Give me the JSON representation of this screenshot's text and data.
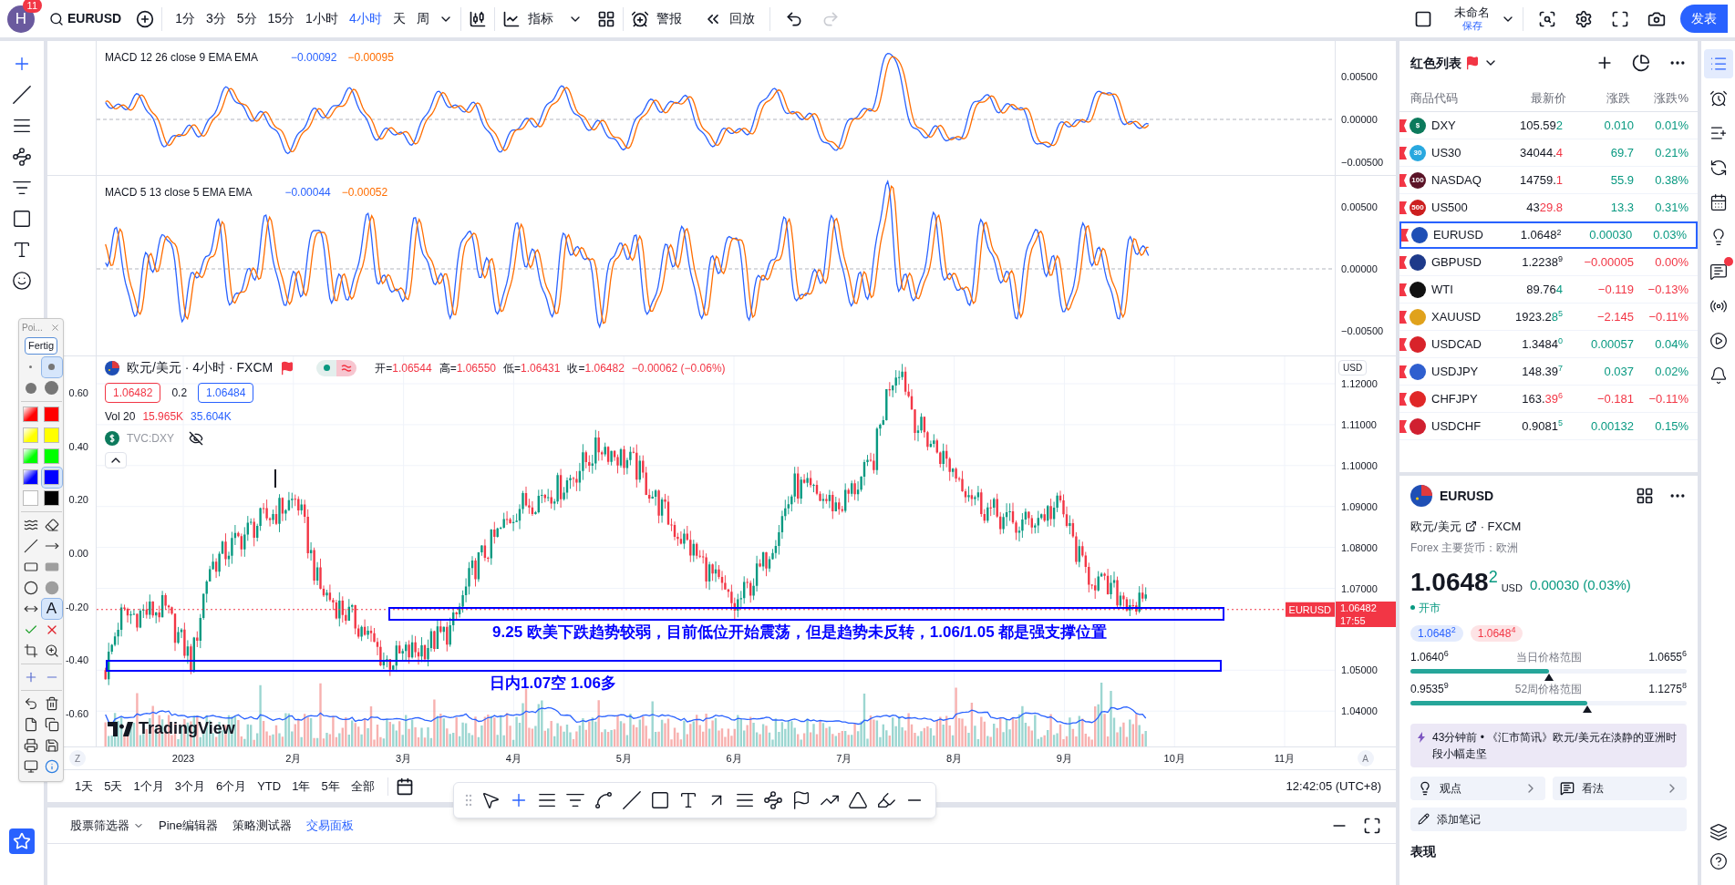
{
  "topbar": {
    "avatar": "H",
    "badge": "11",
    "symbol": "EURUSD",
    "intervals": [
      {
        "label": "1分",
        "selected": false
      },
      {
        "label": "3分",
        "selected": false
      },
      {
        "label": "5分",
        "selected": false
      },
      {
        "label": "15分",
        "selected": false
      },
      {
        "label": "1小时",
        "selected": false
      },
      {
        "label": "4小时",
        "selected": true
      },
      {
        "label": "天",
        "selected": false
      },
      {
        "label": "周",
        "selected": false
      }
    ],
    "indicators": "指标",
    "alert": "警报",
    "replay": "回放",
    "redo_disabled": true,
    "layout_name": "未命名",
    "save": "保存",
    "publish": "发表"
  },
  "left_tools": [
    {
      "kind": "crosshair",
      "selected": true
    },
    {
      "kind": "line",
      "selected": false
    },
    {
      "kind": "hlines",
      "selected": false
    },
    {
      "kind": "pattern",
      "selected": false
    },
    {
      "kind": "fib",
      "selected": false
    },
    {
      "kind": "rect",
      "selected": false
    },
    {
      "kind": "text",
      "selected": false
    },
    {
      "kind": "emoji",
      "selected": false
    }
  ],
  "panes": [
    {
      "kind": "macd_slow",
      "legend": "MACD 12 26 close 9 EMA EMA",
      "values": [
        {
          "text": "−0.00092",
          "color": "#2962ff"
        },
        {
          "text": "−0.00095",
          "color": "#ff6d00"
        }
      ],
      "yticks": [
        "0.00500",
        "0.00000",
        "−0.00500"
      ]
    },
    {
      "kind": "macd_fast",
      "legend": "MACD 5 13 close 5 EMA EMA",
      "values": [
        {
          "text": "−0.00044",
          "color": "#2962ff"
        },
        {
          "text": "−0.00052",
          "color": "#ff6d00"
        }
      ],
      "yticks": [
        "0.00500",
        "0.00000",
        "−0.00500"
      ]
    }
  ],
  "main": {
    "title": "欧元/美元 · 4小时 · FXCM",
    "ohlc": [
      {
        "label": "开=",
        "value": "1.06544"
      },
      {
        "label": "高=",
        "value": "1.06550"
      },
      {
        "label": "低=",
        "value": "1.06431"
      },
      {
        "label": "收=",
        "value": "1.06482"
      }
    ],
    "change": "−0.00062 (−0.06%)",
    "bid": "1.06482",
    "spread": "0.2",
    "ask": "1.06484",
    "volume": {
      "label": "Vol 20",
      "values": [
        {
          "text": "15.965K",
          "color": "#f23645"
        },
        {
          "text": "35.604K",
          "color": "#2962ff"
        }
      ]
    },
    "compare": "TVC:DXY",
    "unit": "USD",
    "right_ticks": [
      "1.12000",
      "1.11000",
      "1.10000",
      "1.09000",
      "1.08000",
      "1.07000",
      "1.05000",
      "1.04000"
    ],
    "left_ticks": [
      "0.60",
      "0.40",
      "0.20",
      "0.00",
      "-0.20",
      "-0.40",
      "-0.60"
    ],
    "price_tag": {
      "symbol": "EURUSD",
      "price": "1.06482",
      "countdown": "17:55"
    },
    "annotations": [
      {
        "kind": "box_upper"
      },
      {
        "kind": "text_upper",
        "text": "9.25 欧美下跌趋势较弱，目前低位开始震荡，但是趋势未反转，1.06/1.05 都是强支撑位置"
      },
      {
        "kind": "box_lower"
      },
      {
        "kind": "text_lower",
        "text": "日内1.07空 1.06多"
      }
    ],
    "logo": "TradingView"
  },
  "time_axis": {
    "start": "Z",
    "labels": [
      "2023",
      "2月",
      "3月",
      "4月",
      "5月",
      "6月",
      "7月",
      "8月",
      "9月",
      "10月",
      "11月"
    ],
    "end": "A"
  },
  "ranges": [
    "1天",
    "5天",
    "1个月",
    "3个月",
    "6个月",
    "YTD",
    "1年",
    "5年",
    "全部"
  ],
  "clock": "12:42:05 (UTC+8)",
  "bottom_tabs": [
    {
      "label": "股票筛选器",
      "dropdown": true,
      "selected": false
    },
    {
      "label": "Pine编辑器",
      "dropdown": false,
      "selected": false
    },
    {
      "label": "策略测试器",
      "dropdown": false,
      "selected": false
    },
    {
      "label": "交易面板",
      "dropdown": false,
      "selected": true
    }
  ],
  "draw_toolbar": [
    {
      "kind": "cursor",
      "selected": false
    },
    {
      "kind": "crosshair",
      "selected": true
    },
    {
      "kind": "hlines",
      "selected": false
    },
    {
      "kind": "channel",
      "selected": false
    },
    {
      "kind": "curve",
      "selected": false
    },
    {
      "kind": "line",
      "selected": false
    },
    {
      "kind": "rect",
      "selected": false
    },
    {
      "kind": "text",
      "selected": false
    },
    {
      "kind": "arrow",
      "selected": false
    },
    {
      "kind": "lines",
      "selected": false
    },
    {
      "kind": "pattern",
      "selected": false
    },
    {
      "kind": "flag",
      "selected": false
    },
    {
      "kind": "path",
      "selected": false
    },
    {
      "kind": "triangle",
      "selected": false
    },
    {
      "kind": "brush",
      "selected": false
    },
    {
      "kind": "ray",
      "selected": false
    }
  ],
  "palette": {
    "title": "Poi...",
    "done": "Fertig",
    "sizes": [
      {
        "kind": "xs",
        "selected": false
      },
      {
        "kind": "s",
        "selected": true
      },
      {
        "kind": "m",
        "selected": false
      },
      {
        "kind": "l",
        "selected": false
      }
    ],
    "colors": [
      {
        "color": "#ff0000",
        "gradient": true,
        "selected": false
      },
      {
        "color": "#ff0000",
        "gradient": false,
        "selected": false
      },
      {
        "color": "#ffff00",
        "gradient": true,
        "selected": false
      },
      {
        "color": "#ffff00",
        "gradient": false,
        "selected": false
      },
      {
        "color": "#00ff00",
        "gradient": true,
        "selected": false
      },
      {
        "color": "#00ff00",
        "gradient": false,
        "selected": false
      },
      {
        "color": "#0000ff",
        "gradient": true,
        "selected": false
      },
      {
        "color": "#0000ff",
        "gradient": false,
        "selected": true
      },
      {
        "color": "#ffffff",
        "selected": false
      },
      {
        "color": "#000000",
        "selected": false
      }
    ],
    "tool_groups": [
      {
        "tools": [
          {
            "kind": "wave",
            "selected": false
          },
          {
            "kind": "eraser",
            "selected": false
          },
          {
            "kind": "line",
            "selected": false
          },
          {
            "kind": "arrow",
            "selected": false
          },
          {
            "kind": "rect",
            "selected": false
          },
          {
            "kind": "rect_fill",
            "selected": false
          },
          {
            "kind": "ellipse",
            "selected": false
          },
          {
            "kind": "ellipse_fill",
            "selected": false
          },
          {
            "kind": "double_arrow",
            "selected": false
          },
          {
            "kind": "text",
            "label": "A",
            "selected": true
          },
          {
            "kind": "check",
            "selected": false
          },
          {
            "kind": "cross",
            "selected": false
          },
          {
            "kind": "crop",
            "selected": false
          },
          {
            "kind": "zoom",
            "selected": false
          }
        ]
      },
      {
        "tools": [
          {
            "kind": "plus",
            "selected": false
          },
          {
            "kind": "minus",
            "selected": false
          }
        ]
      },
      {
        "tools": [
          {
            "kind": "undo",
            "selected": false
          },
          {
            "kind": "trash",
            "selected": false
          },
          {
            "kind": "new",
            "selected": false
          },
          {
            "kind": "copy",
            "selected": false
          },
          {
            "kind": "print",
            "selected": false
          },
          {
            "kind": "save",
            "selected": false
          },
          {
            "kind": "capture",
            "selected": false
          },
          {
            "kind": "info",
            "selected": false
          }
        ]
      }
    ]
  },
  "watchlist": {
    "title": "红色列表",
    "columns": [
      "商品代码",
      "最新价",
      "涨跌",
      "涨跌%"
    ],
    "rows": [
      {
        "symbol": "DXY",
        "logo": "$",
        "color": "#0c7a5c",
        "price": "105.59",
        "tail": "2",
        "tail_up": true,
        "tail_down": false,
        "change": "0.010",
        "pct": "0.01%",
        "up": true,
        "selected": false
      },
      {
        "symbol": "US30",
        "logo": "30",
        "color": "#29a8df",
        "price": "34044.",
        "tail": "4",
        "tail_up": false,
        "tail_down": true,
        "change": "69.7",
        "pct": "0.21%",
        "up": true,
        "selected": false
      },
      {
        "symbol": "NASDAQ",
        "logo": "100",
        "color": "#5b1427",
        "price": "14759.",
        "tail": "1",
        "tail_up": false,
        "tail_down": true,
        "change": "55.9",
        "pct": "0.38%",
        "up": true,
        "selected": false
      },
      {
        "symbol": "US500",
        "logo": "500",
        "color": "#cc1f1f",
        "price": "43",
        "tail": "29.8",
        "tail_up": false,
        "tail_down": true,
        "change": "13.3",
        "pct": "0.31%",
        "up": true,
        "selected": false
      },
      {
        "symbol": "EURUSD",
        "color": "#1f4fb5",
        "price": "1.0648",
        "sup": "2",
        "tail_up": false,
        "tail_down": false,
        "change": "0.00030",
        "pct": "0.03%",
        "up": true,
        "selected": true
      },
      {
        "symbol": "GBPUSD",
        "color": "#1e3a8a",
        "price": "1.2238",
        "sup": "9",
        "tail_up": false,
        "tail_down": false,
        "change": "−0.00005",
        "pct": "0.00%",
        "up": false,
        "selected": false
      },
      {
        "symbol": "WTI",
        "color": "#111111",
        "price": "89.76",
        "tail": "4",
        "tail_up": true,
        "tail_down": false,
        "change": "−0.119",
        "pct": "−0.13%",
        "up": false,
        "selected": false
      },
      {
        "symbol": "XAUUSD",
        "color": "#e0a21c",
        "price": "1923.2",
        "tail": "8",
        "sup": "5",
        "tail_up": true,
        "tail_down": false,
        "change": "−2.145",
        "pct": "−0.11%",
        "up": false,
        "selected": false
      },
      {
        "symbol": "USDCAD",
        "color": "#d8232a",
        "price": "1.3484",
        "sup": "0",
        "tail_up": true,
        "tail_down": false,
        "change": "0.00057",
        "pct": "0.04%",
        "up": true,
        "selected": false
      },
      {
        "symbol": "USDJPY",
        "color": "#2f5fcf",
        "price": "148.39",
        "sup": "7",
        "tail_up": true,
        "tail_down": false,
        "change": "0.037",
        "pct": "0.02%",
        "up": true,
        "selected": false
      },
      {
        "symbol": "CHFJPY",
        "color": "#e02828",
        "price": "163.",
        "tail": "39",
        "sup": "6",
        "tail_up": false,
        "tail_down": true,
        "change": "−0.181",
        "pct": "−0.11%",
        "up": false,
        "selected": false
      },
      {
        "symbol": "USDCHF",
        "color": "#d02030",
        "price": "0.9081",
        "sup": "5",
        "tail_up": true,
        "tail_down": false,
        "change": "0.00132",
        "pct": "0.15%",
        "up": true,
        "selected": false
      }
    ]
  },
  "details": {
    "symbol": "EURUSD",
    "name": "欧元/美元",
    "exchange": "· FXCM",
    "category": "Forex 主要货币：欧洲",
    "price": "1.0648",
    "price_sup": "2",
    "currency": "USD",
    "change": "0.00030 (0.03%)",
    "status": "开市",
    "market_open": true,
    "bid": {
      "price": "1.0648",
      "sup": "2"
    },
    "ask": {
      "price": "1.0648",
      "sup": "4"
    },
    "ranges": [
      {
        "low": "1.0640",
        "low_sup": "6",
        "label": "当日价格范围",
        "high": "1.0655",
        "high_sup": "6",
        "level": 0.5
      },
      {
        "low": "0.9535",
        "low_sup": "9",
        "label": "52周价格范围",
        "high": "1.1275",
        "high_sup": "8",
        "level": 0.64
      }
    ],
    "news": "43分钟前 • 《汇市简讯》欧元/美元在淡静的亚洲时段小幅走坚",
    "actions": [
      "观点",
      "看法"
    ],
    "note": "添加笔记",
    "section": "表现"
  },
  "right_bar": [
    {
      "kind": "watchlist",
      "selected": true,
      "badge": false
    },
    {
      "kind": "alarm",
      "selected": false,
      "badge": false
    },
    {
      "kind": "list_plus",
      "selected": false,
      "badge": false
    },
    {
      "kind": "hotlist",
      "selected": false,
      "badge": false
    },
    {
      "kind": "calendar",
      "selected": false,
      "badge": false
    },
    {
      "kind": "ideas",
      "selected": false,
      "badge": false
    },
    {
      "kind": "chat",
      "selected": false,
      "badge": true
    },
    {
      "kind": "streams",
      "selected": false,
      "badge": false
    },
    {
      "kind": "play",
      "selected": false,
      "badge": false
    },
    {
      "kind": "bell",
      "selected": false,
      "badge": false
    }
  ]
}
